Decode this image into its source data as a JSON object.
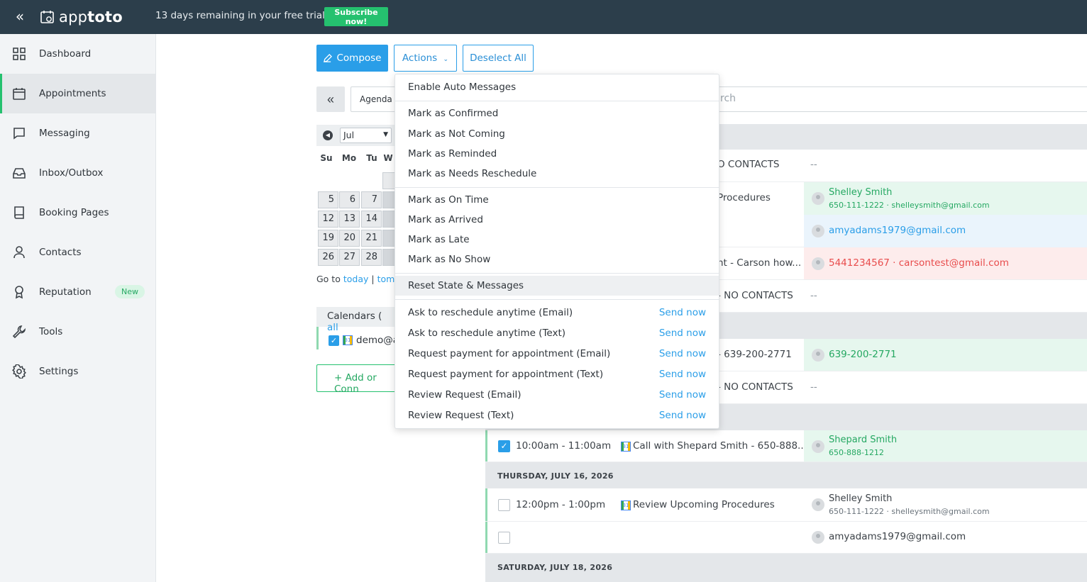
{
  "topbar": {
    "brand_light": "app",
    "brand_bold": "toto",
    "trial_text": "13 days remaining in your free trial.",
    "subscribe_label": "Subscribe now!"
  },
  "sidebar": {
    "items": [
      {
        "label": "Dashboard",
        "icon": "grid-icon"
      },
      {
        "label": "Appointments",
        "icon": "calendar-icon",
        "active": true
      },
      {
        "label": "Messaging",
        "icon": "chat-icon"
      },
      {
        "label": "Inbox/Outbox",
        "icon": "inbox-icon"
      },
      {
        "label": "Booking Pages",
        "icon": "book-icon"
      },
      {
        "label": "Contacts",
        "icon": "person-icon"
      },
      {
        "label": "Reputation",
        "icon": "ribbon-icon",
        "badge": "New"
      },
      {
        "label": "Tools",
        "icon": "wrench-icon"
      },
      {
        "label": "Settings",
        "icon": "gear-icon"
      }
    ]
  },
  "toolbar": {
    "compose_label": "Compose",
    "actions_label": "Actions",
    "deselect_label": "Deselect All",
    "view_value": "Agenda",
    "search_placeholder": "rch"
  },
  "mini_calendar": {
    "month": "Jul",
    "weekdays": [
      "Su",
      "Mo",
      "Tu",
      "W"
    ],
    "weeks": [
      [
        "5",
        "6",
        "7"
      ],
      [
        "12",
        "13",
        "14"
      ],
      [
        "19",
        "20",
        "21"
      ],
      [
        "26",
        "27",
        "28"
      ]
    ],
    "goto_label": "Go to",
    "today_link": "today",
    "separator": "|",
    "tomorrow_link": "tom"
  },
  "calendars": {
    "title": "Calendars (",
    "all_link": "all",
    "item_label": "demo@a",
    "add_label": "+ Add or Conn"
  },
  "actions_menu": {
    "group1": [
      "Enable Auto Messages"
    ],
    "group2": [
      "Mark as Confirmed",
      "Mark as Not Coming",
      "Mark as Reminded",
      "Mark as Needs Reschedule"
    ],
    "group3": [
      "Mark as On Time",
      "Mark as Arrived",
      "Mark as Late",
      "Mark as No Show"
    ],
    "group4": [
      "Reset State & Messages"
    ],
    "send_items": [
      "Ask to reschedule anytime (Email)",
      "Ask to reschedule anytime (Text)",
      "Request payment for appointment (Email)",
      "Request payment for appointment (Text)",
      "Review Request (Email)",
      "Review Request (Text)"
    ],
    "send_label": "Send now"
  },
  "agenda": {
    "row1_title": "O CONTACTS",
    "row1_contact": "--",
    "row2_title": "Procedures",
    "row2_c1_name": "Shelley Smith",
    "row2_c1_sub": "650-111-1222 · shelleysmith@gmail.com",
    "row2_c2_name": "amyadams1979@gmail.com",
    "row3_title": "nt - Carson how...",
    "row3_contact": "5441234567 · carsontest@gmail.com",
    "row4_title": "- NO CONTACTS",
    "row4_contact": "--",
    "row5_title": "- 639-200-2771",
    "row5_contact": "639-200-2771",
    "row6_title": "- NO CONTACTS",
    "row6_contact": "--",
    "row7_time": "10:00am - 11:00am",
    "row7_title": "Call with Shepard Smith - 650-888...",
    "row7_name": "Shepard Smith",
    "row7_sub": "650-888-1212",
    "day_thursday": "THURSDAY, JULY 16, 2026",
    "row8_time": "12:00pm - 1:00pm",
    "row8_title": "Review Upcoming Procedures",
    "row8_name": "Shelley Smith",
    "row8_sub": "650-111-1222 · shelleysmith@gmail.com",
    "row9_contact": "amyadams1979@gmail.com",
    "day_saturday": "SATURDAY, JULY 18, 2026"
  },
  "colors": {
    "topbar": "#2c3e4b",
    "accent_blue": "#2a9ee8",
    "accent_green": "#25c16f",
    "error_red": "#e84c4c"
  }
}
